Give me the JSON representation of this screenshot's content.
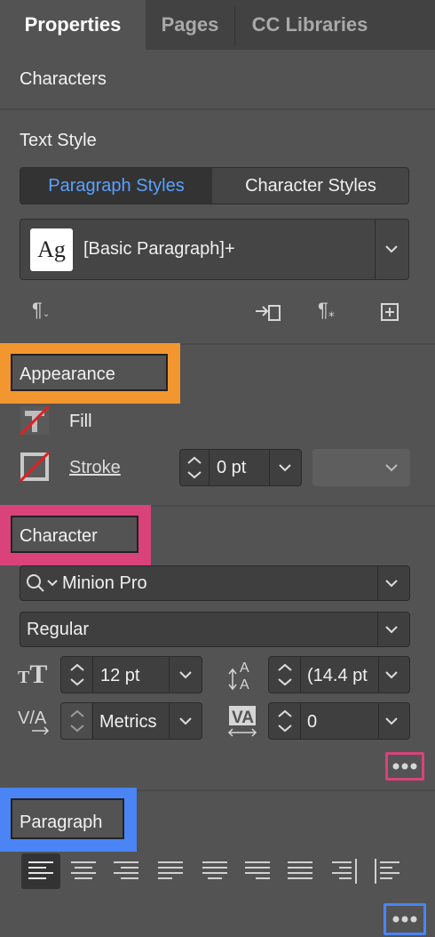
{
  "tabs": [
    "Properties",
    "Pages",
    "CC Libraries"
  ],
  "section_characters": "Characters",
  "text_style": {
    "heading": "Text Style",
    "toggle": [
      "Paragraph Styles",
      "Character Styles"
    ],
    "style_preview": "Ag",
    "style_value": "[Basic Paragraph]+"
  },
  "appearance": {
    "heading": "Appearance",
    "fill_label": "Fill",
    "stroke_label": "Stroke",
    "stroke_weight": "0 pt"
  },
  "character": {
    "heading": "Character",
    "font_family": "Minion Pro",
    "font_style": "Regular",
    "font_size": "12 pt",
    "leading": "(14.4 pt",
    "kerning": "Metrics",
    "tracking": "0"
  },
  "paragraph": {
    "heading": "Paragraph"
  },
  "colors": {
    "orange": "#f2972f",
    "pink": "#d9437a",
    "blue": "#4a84f5",
    "accent_blue": "#5aa1ff"
  }
}
